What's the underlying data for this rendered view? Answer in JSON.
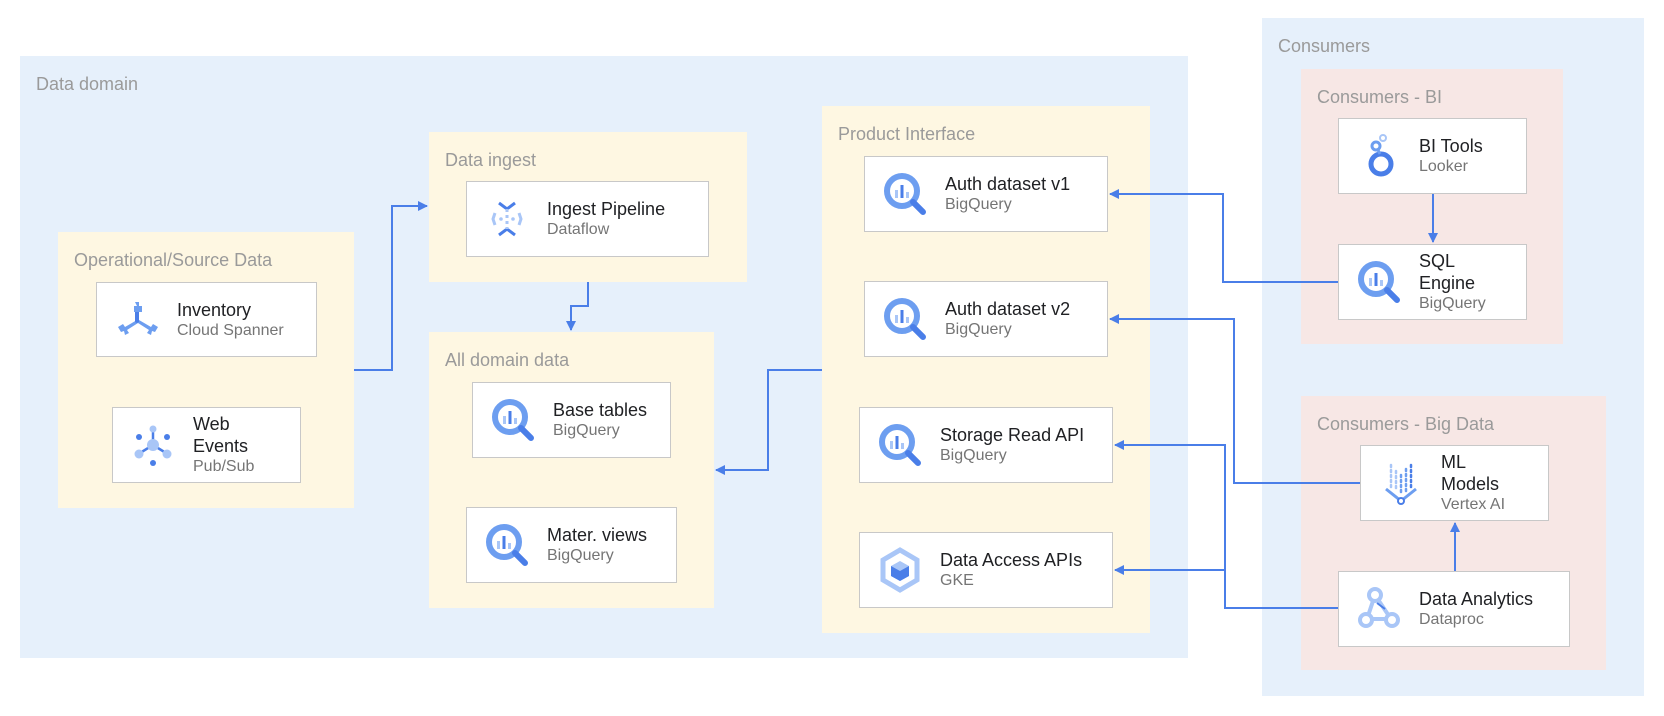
{
  "colors": {
    "accent": "#4a7ee8",
    "zone_blue": "#e6f0fb",
    "zone_yellow": "#fef7e2",
    "zone_pink": "#f7e7e5",
    "label_gray": "#9a9a9a"
  },
  "zones": {
    "data_domain": {
      "label": "Data domain"
    },
    "operational": {
      "label": "Operational/Source Data"
    },
    "data_ingest": {
      "label": "Data ingest"
    },
    "all_domain": {
      "label": "All domain data"
    },
    "product_interface": {
      "label": "Product Interface"
    },
    "consumers": {
      "label": "Consumers"
    },
    "consumers_bi": {
      "label": "Consumers - BI"
    },
    "consumers_bigdata": {
      "label": "Consumers - Big Data"
    }
  },
  "nodes": {
    "inventory": {
      "title": "Inventory",
      "sub": "Cloud Spanner",
      "icon": "cloud-spanner-icon"
    },
    "web_events": {
      "title": "Web\nEvents",
      "sub": "Pub/Sub",
      "icon": "pubsub-icon"
    },
    "ingest": {
      "title": "Ingest Pipeline",
      "sub": "Dataflow",
      "icon": "dataflow-icon"
    },
    "base_tables": {
      "title": "Base tables",
      "sub": "BigQuery",
      "icon": "bigquery-icon"
    },
    "mater_views": {
      "title": "Mater. views",
      "sub": "BigQuery",
      "icon": "bigquery-icon"
    },
    "auth_v1": {
      "title": "Auth dataset v1",
      "sub": "BigQuery",
      "icon": "bigquery-icon"
    },
    "auth_v2": {
      "title": "Auth dataset v2",
      "sub": "BigQuery",
      "icon": "bigquery-icon"
    },
    "storage_read": {
      "title": "Storage Read API",
      "sub": "BigQuery",
      "icon": "bigquery-icon"
    },
    "data_access": {
      "title": "Data Access APIs",
      "sub": "GKE",
      "icon": "gke-icon"
    },
    "bi_tools": {
      "title": "BI Tools",
      "sub": "Looker",
      "icon": "looker-icon"
    },
    "sql_engine": {
      "title": "SQL\nEngine",
      "sub": "BigQuery",
      "icon": "bigquery-icon"
    },
    "ml_models": {
      "title": "ML\nModels",
      "sub": "Vertex AI",
      "icon": "vertex-ai-icon"
    },
    "data_analytics": {
      "title": "Data Analytics",
      "sub": "Dataproc",
      "icon": "dataproc-icon"
    }
  },
  "edges": [
    {
      "from": "operational",
      "to": "data_ingest"
    },
    {
      "from": "data_ingest",
      "to": "all_domain"
    },
    {
      "from": "product_interface",
      "to": "all_domain"
    },
    {
      "from": "sql_engine",
      "to": "auth_v1"
    },
    {
      "from": "ml_models",
      "to": "auth_v2"
    },
    {
      "from": "data_analytics",
      "to": "storage_read"
    },
    {
      "from": "data_analytics",
      "to": "data_access"
    },
    {
      "from": "bi_tools",
      "to": "sql_engine"
    },
    {
      "from": "data_analytics",
      "to": "ml_models"
    }
  ]
}
